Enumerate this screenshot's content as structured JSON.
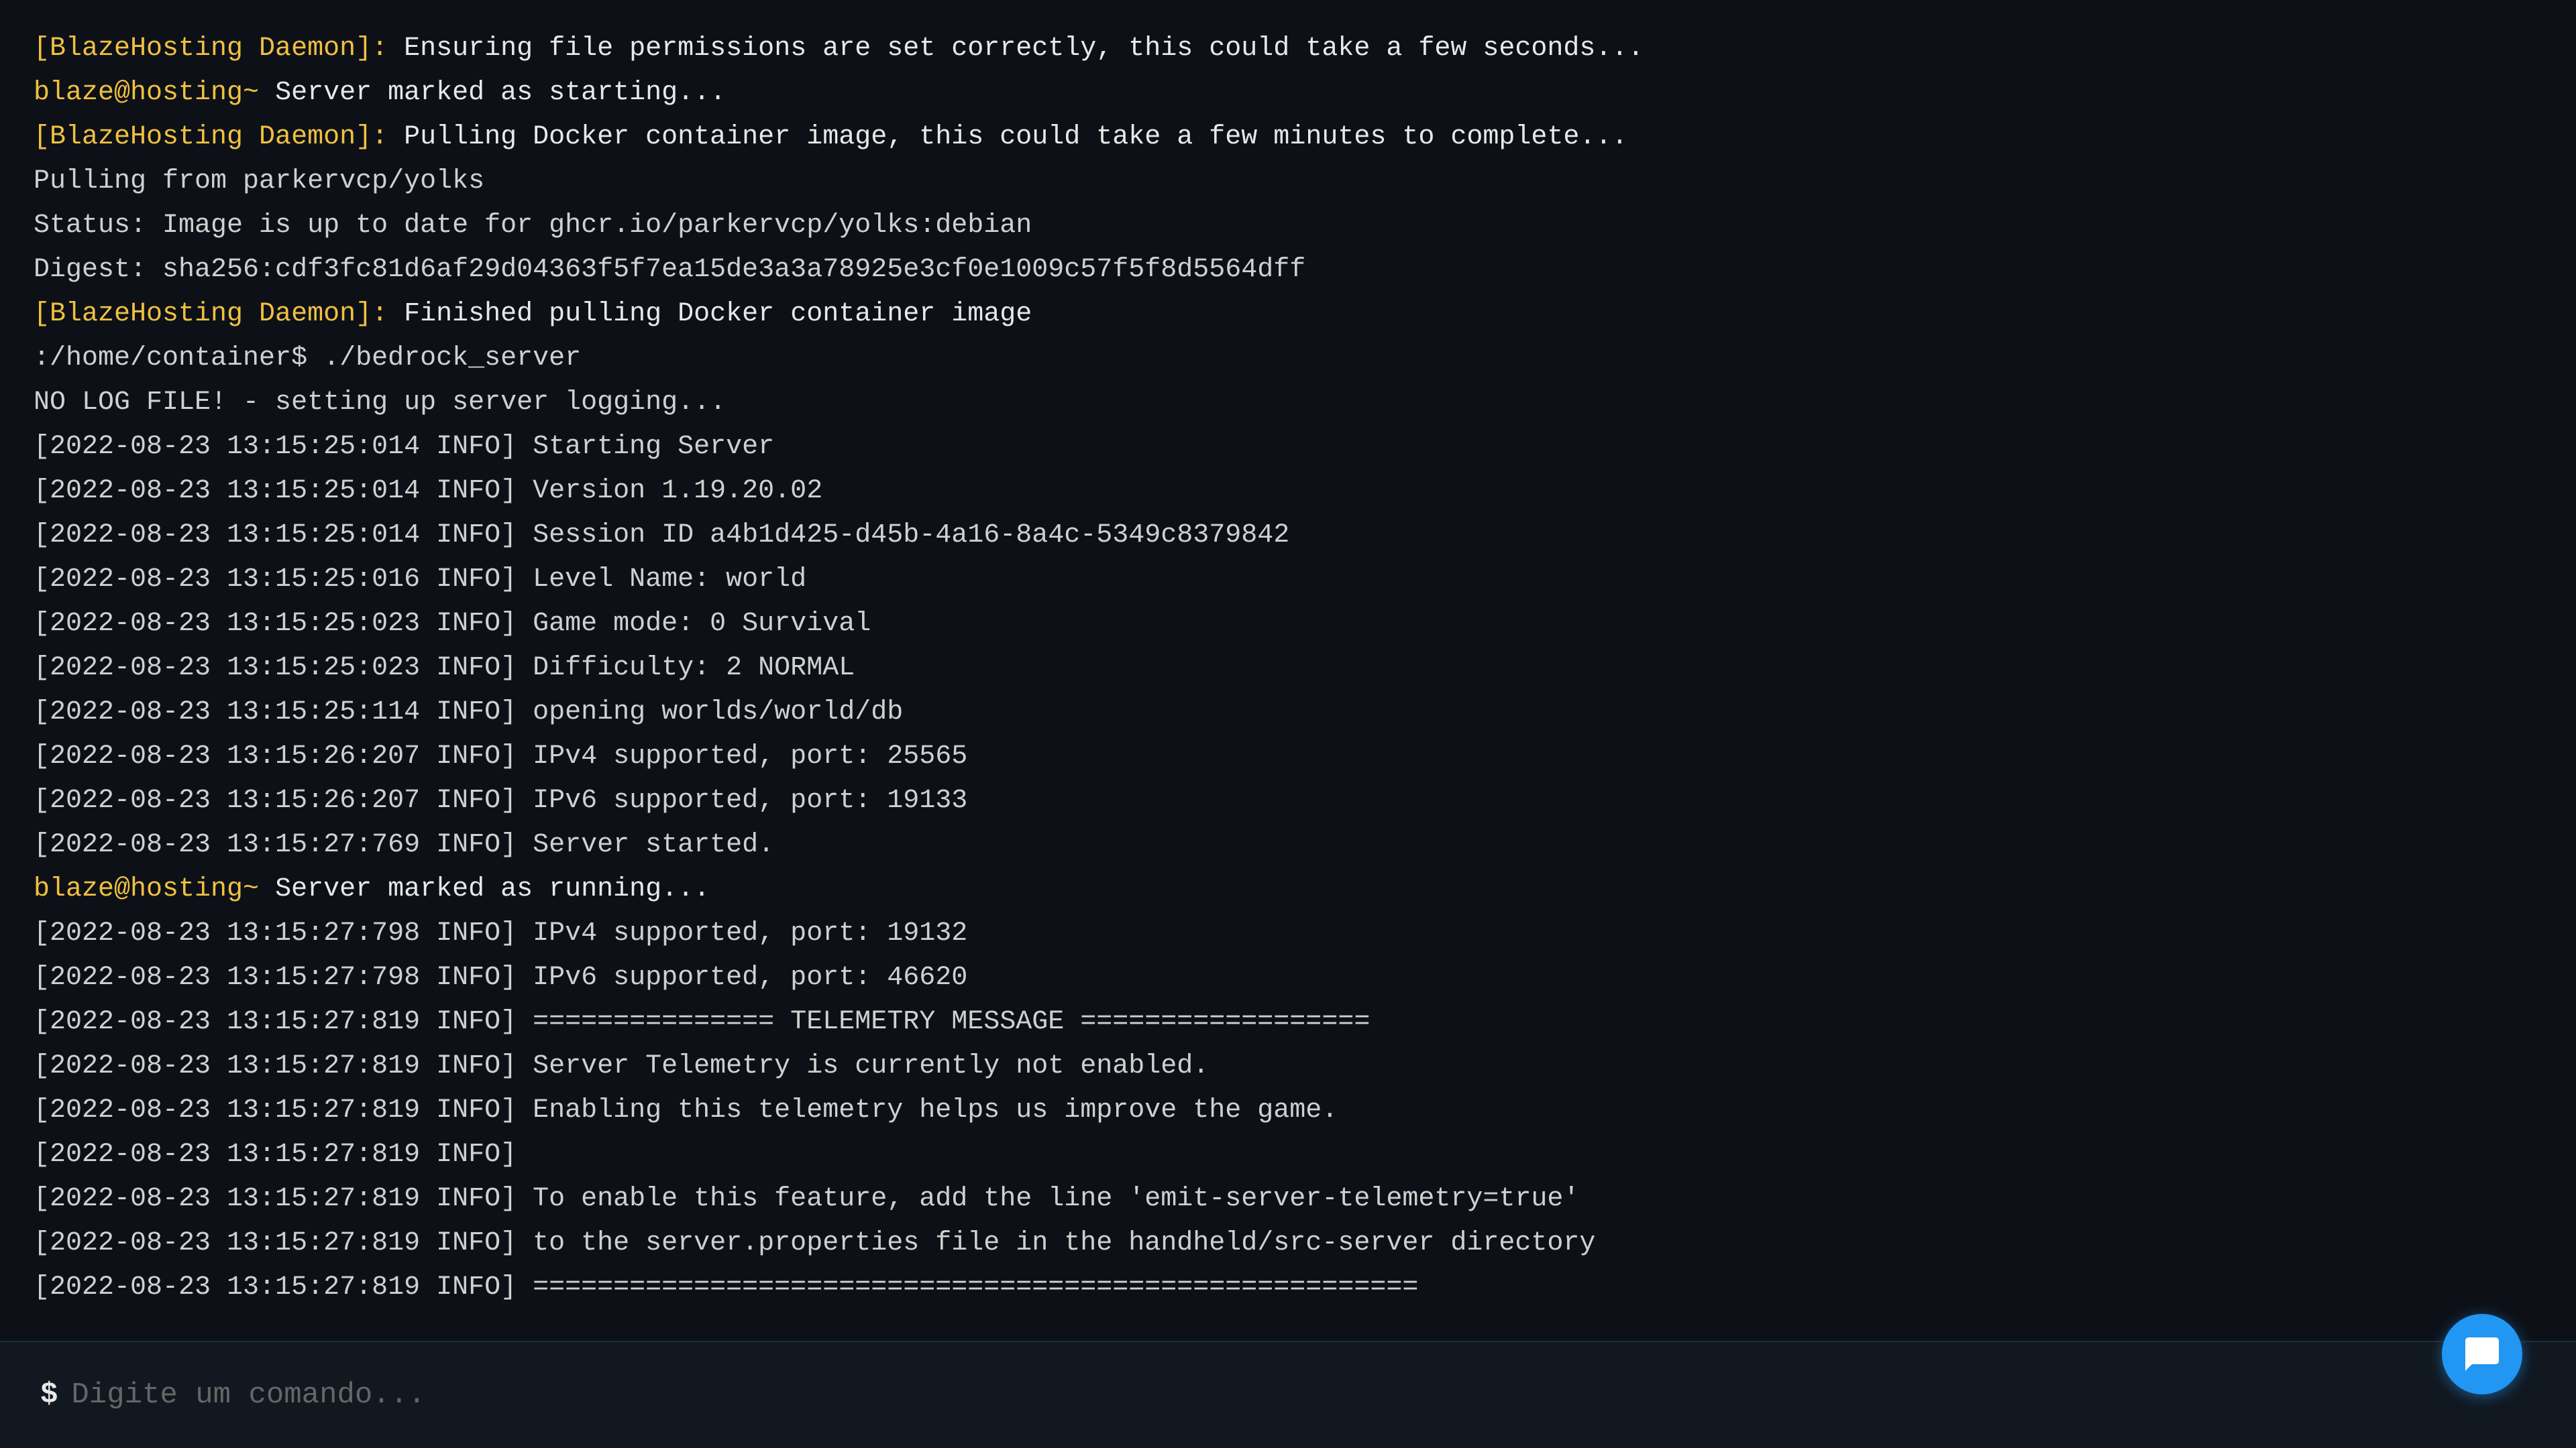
{
  "terminal": {
    "lines": [
      {
        "type": "daemon",
        "prefix": "[BlazeHosting Daemon]:",
        "text": " Ensuring file permissions are set correctly, this could take a few seconds...",
        "prefix_color": "yellow"
      },
      {
        "type": "system",
        "prefix": "blaze@hosting~",
        "text": " Server marked as starting...",
        "prefix_color": "yellow"
      },
      {
        "type": "daemon",
        "prefix": "[BlazeHosting Daemon]:",
        "text": " Pulling Docker container image, this could take a few minutes to complete...",
        "prefix_color": "yellow"
      },
      {
        "type": "plain",
        "text": "Pulling from parkervcp/yolks"
      },
      {
        "type": "plain",
        "text": "Status: Image is up to date for ghcr.io/parkervcp/yolks:debian"
      },
      {
        "type": "plain",
        "text": "Digest: sha256:cdf3fc81d6af29d04363f5f7ea15de3a3a78925e3cf0e1009c57f5f8d5564dff"
      },
      {
        "type": "daemon",
        "prefix": "[BlazeHosting Daemon]:",
        "text": " Finished pulling Docker container image",
        "prefix_color": "yellow"
      },
      {
        "type": "plain",
        "text": ":/home/container$ ./bedrock_server"
      },
      {
        "type": "plain",
        "text": "NO LOG FILE! - setting up server logging..."
      },
      {
        "type": "plain",
        "text": "[2022-08-23 13:15:25:014 INFO] Starting Server"
      },
      {
        "type": "plain",
        "text": "[2022-08-23 13:15:25:014 INFO] Version 1.19.20.02"
      },
      {
        "type": "plain",
        "text": "[2022-08-23 13:15:25:014 INFO] Session ID a4b1d425-d45b-4a16-8a4c-5349c8379842"
      },
      {
        "type": "plain",
        "text": "[2022-08-23 13:15:25:016 INFO] Level Name: world"
      },
      {
        "type": "plain",
        "text": "[2022-08-23 13:15:25:023 INFO] Game mode: 0 Survival"
      },
      {
        "type": "plain",
        "text": "[2022-08-23 13:15:25:023 INFO] Difficulty: 2 NORMAL"
      },
      {
        "type": "plain",
        "text": "[2022-08-23 13:15:25:114 INFO] opening worlds/world/db"
      },
      {
        "type": "plain",
        "text": "[2022-08-23 13:15:26:207 INFO] IPv4 supported, port: 25565"
      },
      {
        "type": "plain",
        "text": "[2022-08-23 13:15:26:207 INFO] IPv6 supported, port: 19133"
      },
      {
        "type": "plain",
        "text": "[2022-08-23 13:15:27:769 INFO] Server started."
      },
      {
        "type": "system",
        "prefix": "blaze@hosting~",
        "text": " Server marked as running...",
        "prefix_color": "yellow"
      },
      {
        "type": "plain",
        "text": "[2022-08-23 13:15:27:798 INFO] IPv4 supported, port: 19132"
      },
      {
        "type": "plain",
        "text": "[2022-08-23 13:15:27:798 INFO] IPv6 supported, port: 46620"
      },
      {
        "type": "plain",
        "text": "[2022-08-23 13:15:27:819 INFO] =============== TELEMETRY MESSAGE =================="
      },
      {
        "type": "plain",
        "text": "[2022-08-23 13:15:27:819 INFO] Server Telemetry is currently not enabled."
      },
      {
        "type": "plain",
        "text": "[2022-08-23 13:15:27:819 INFO] Enabling this telemetry helps us improve the game."
      },
      {
        "type": "plain",
        "text": "[2022-08-23 13:15:27:819 INFO]"
      },
      {
        "type": "plain",
        "text": "[2022-08-23 13:15:27:819 INFO] To enable this feature, add the line 'emit-server-telemetry=true'"
      },
      {
        "type": "plain",
        "text": "[2022-08-23 13:15:27:819 INFO] to the server.properties file in the handheld/src-server directory"
      },
      {
        "type": "plain",
        "text": "[2022-08-23 13:15:27:819 INFO] ======================================================="
      }
    ],
    "input_placeholder": "Digite um comando...",
    "input_prompt": "$"
  },
  "chat_button": {
    "label": "Chat"
  }
}
